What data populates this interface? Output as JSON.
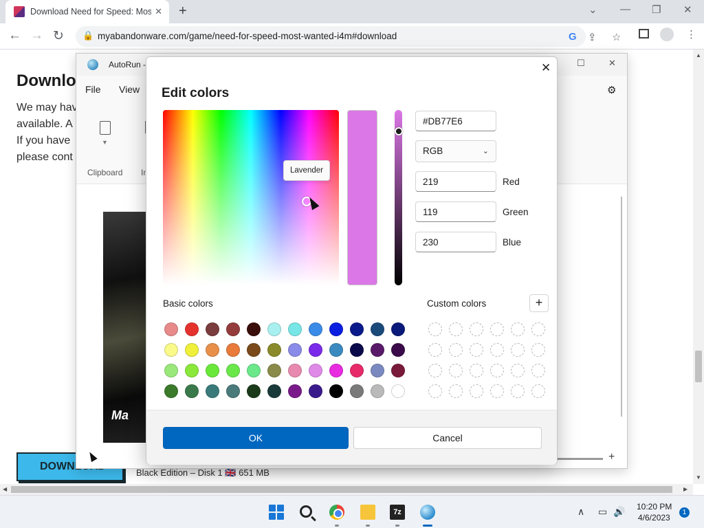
{
  "browser": {
    "tab_title": "Download Need for Speed: Most Wanted",
    "tab_close": "✕",
    "new_tab": "+",
    "url": "myabandonware.com/game/need-for-speed-most-wanted-i4m#download",
    "window_controls": {
      "list": "⌄",
      "minimize": "—",
      "restore": "❐",
      "close": "✕"
    },
    "nav": {
      "back": "←",
      "forward": "→",
      "reload": "↻"
    },
    "omnibox_icons": [
      "google-icon",
      "share-icon",
      "bookmark-star-icon"
    ],
    "toolbar_icons": [
      "side-panel-icon",
      "profile-icon",
      "menu-icon"
    ]
  },
  "page": {
    "heading": "Download",
    "lines": [
      "We may hav",
      "available. A",
      "If you have",
      "please cont"
    ],
    "download_button": "DOWNLOAD",
    "disk_info": "Black Edition – Disk 1 🇬🇧 651 MB",
    "game_logo": "Ma"
  },
  "autorun": {
    "title": "AutoRun -",
    "menus": [
      "File",
      "View"
    ],
    "ribbon": {
      "clipboard": "Clipboard",
      "partial": "In"
    }
  },
  "dialog": {
    "title": "Edit colors",
    "close": "✕",
    "tooltip": "Lavender",
    "hex": "#DB77E6",
    "mode": "RGB",
    "mode_options_selected": "RGB",
    "channels": [
      {
        "name": "Red",
        "value": "219"
      },
      {
        "name": "Green",
        "value": "119"
      },
      {
        "name": "Blue",
        "value": "230"
      }
    ],
    "basic_colors_label": "Basic colors",
    "custom_colors_label": "Custom colors",
    "add_custom": "+",
    "ok": "OK",
    "cancel": "Cancel",
    "current_color": "#DB77E6",
    "basic_colors": [
      [
        "#e88a8a",
        "#e5322d",
        "#7a3c3c",
        "#943c3c",
        "#3a0e0a",
        "#a8f0f0",
        "#78e6e6",
        "#3a8be8",
        "#0a1fe0",
        "#0a1a8a",
        "#1a4a7a",
        "#0a1a7a"
      ],
      [
        "#fafa8a",
        "#f0f03a",
        "#e8904a",
        "#e87a3a",
        "#7a4a1a",
        "#8a8a2a",
        "#8a8ae8",
        "#7a2ae8",
        "#3a8ac0",
        "#0a0a4a",
        "#5a1a6a",
        "#3a0a4a"
      ],
      [
        "#9ae87a",
        "#8ae83a",
        "#6ae83a",
        "#6ae84a",
        "#6ae88a",
        "#8a8a4a",
        "#e88ab0",
        "#e08ae8",
        "#e82ae0",
        "#e82a6a",
        "#7a8ac0",
        "#7a1a3a"
      ],
      [
        "#3a7a2a",
        "#3a7a4a",
        "#3a7a7a",
        "#4a7a7a",
        "#1a3a1a",
        "#1a3a3a",
        "#7a1a8a",
        "#3a1a8a",
        "#000000",
        "#7a7a7a",
        "#bababa",
        "#ffffff"
      ]
    ],
    "custom_slots": 24
  },
  "taskbar": {
    "apps": [
      "start-icon",
      "search-icon",
      "chrome-icon",
      "file-explorer-icon",
      "7zip-icon",
      "autorun-icon"
    ],
    "seven_zip": "7z",
    "tray_chevron": "∧",
    "tray_network": "▭",
    "tray_volume": "🔊",
    "time": "10:20 PM",
    "date": "4/6/2023",
    "notifications": "1"
  }
}
